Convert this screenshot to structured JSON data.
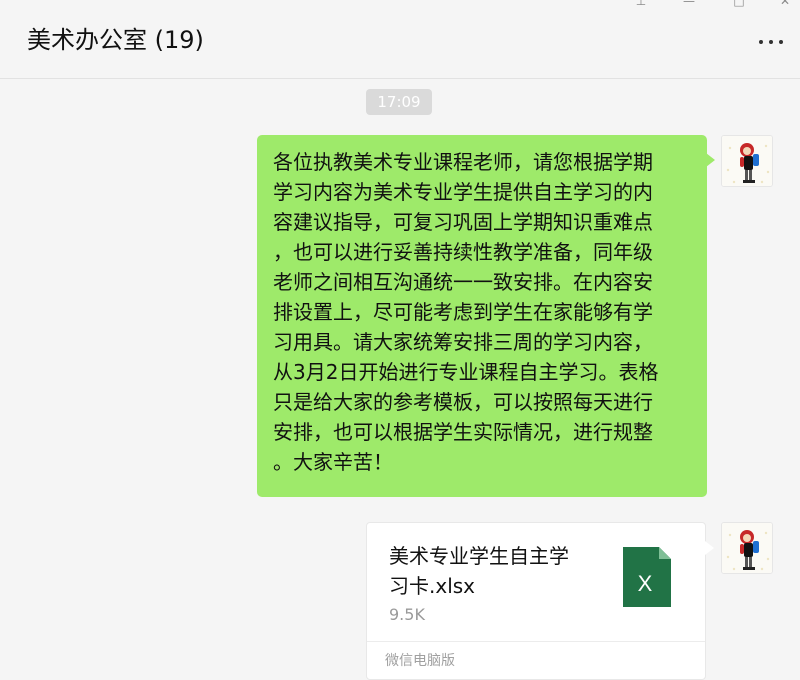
{
  "chat": {
    "title": "美术办公室 (19)"
  },
  "window_controls": [
    {
      "name": "pin-icon",
      "glyph": "⊥"
    },
    {
      "name": "minimize-icon",
      "glyph": "—"
    },
    {
      "name": "maximize-icon",
      "glyph": "□"
    },
    {
      "name": "close-icon",
      "glyph": "✕"
    }
  ],
  "messages": {
    "timestamp": "17:09",
    "text_message": "各位执教美术专业课程老师，请您根据学期\n学习内容为美术专业学生提供自主学习的内\n容建议指导，可复习巩固上学期知识重难点\n，也可以进行妥善持续性教学准备，同年级\n老师之间相互沟通统一一致安排。在内容安\n排设置上，尽可能考虑到学生在家能够有学\n习用具。请大家统筹安排三周的学习内容，\n从3月2日开始进行专业课程自主学习。表格\n只是给大家的参考模板，可以按照每天进行\n安排，也可以根据学生实际情况，进行规整\n。大家辛苦！",
    "file": {
      "name": "美术专业学生自主学\n习卡.xlsx",
      "size": "9.5K",
      "icon_letter": "X",
      "source": "微信电脑版"
    }
  },
  "colors": {
    "bubble_green": "#9eea6a",
    "excel_green": "#217346"
  }
}
